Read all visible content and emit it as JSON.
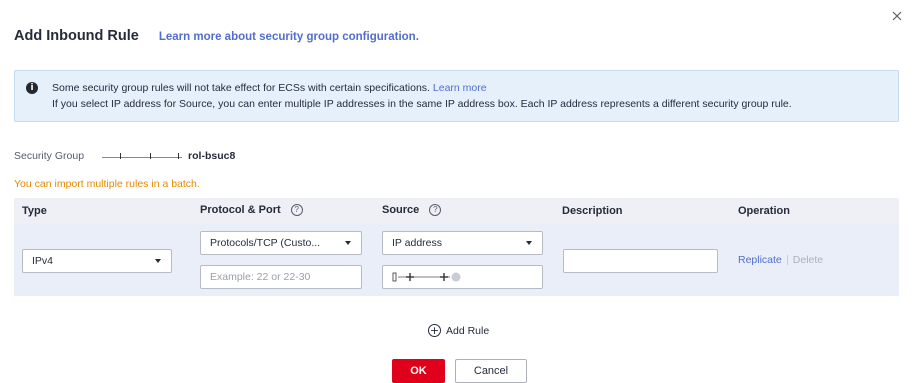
{
  "dialog": {
    "title": "Add Inbound Rule",
    "learn_link": "Learn more about security group configuration.",
    "close_icon": "close-icon"
  },
  "info": {
    "icon": "info-icon",
    "line1_text": "Some security group rules will not take effect for ECSs with certain specifications. ",
    "line1_link": "Learn more",
    "line2_text": "If you select IP address for Source, you can enter multiple IP addresses in the same IP address box. Each IP address represents a different security group rule."
  },
  "security_group": {
    "label": "Security Group",
    "value_suffix": "rol-bsuc8"
  },
  "import": {
    "prefix": "You can ",
    "link": "import multiple rules",
    "suffix": " in a batch."
  },
  "table": {
    "headers": {
      "type": "Type",
      "protocol_port": "Protocol & Port",
      "source": "Source",
      "description": "Description",
      "operation": "Operation"
    },
    "row": {
      "type_value": "IPv4",
      "protocol_value": "Protocols/TCP (Custo...",
      "port_placeholder": "Example: 22 or 22-30",
      "source_value": "IP address",
      "description_value": "",
      "replicate": "Replicate",
      "delete": "Delete"
    }
  },
  "actions": {
    "add_rule": "Add Rule",
    "ok": "OK",
    "cancel": "Cancel"
  },
  "colors": {
    "primary_red": "#e0001b",
    "link_blue": "#526ecc",
    "warning_orange": "#e68a00",
    "info_bg": "#e6f0fb"
  }
}
